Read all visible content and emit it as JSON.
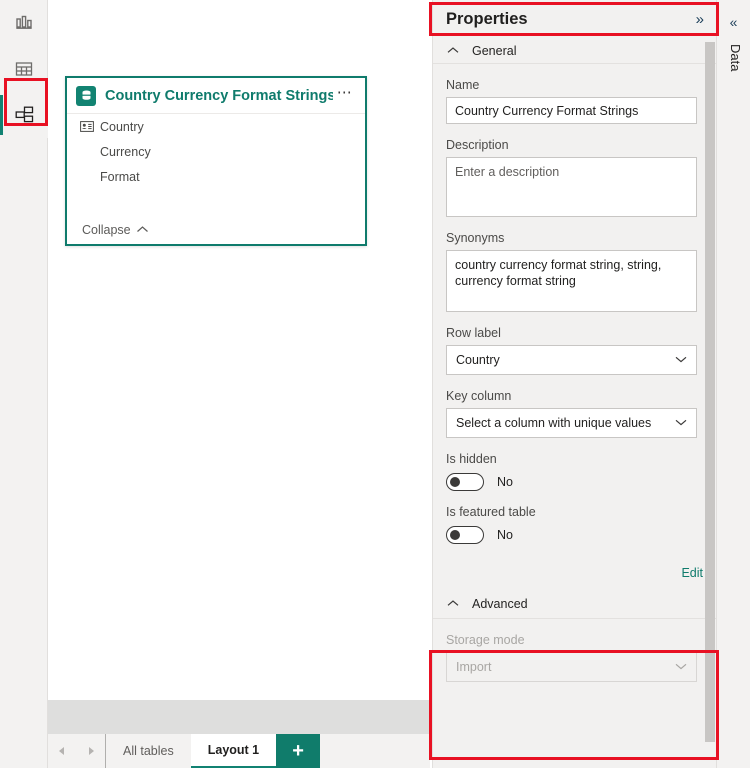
{
  "left_rail": {
    "items": [
      {
        "name": "report-view",
        "icon": "bar-chart-icon",
        "active": false
      },
      {
        "name": "data-view",
        "icon": "table-grid-icon",
        "active": false
      },
      {
        "name": "model-view",
        "icon": "model-relationship-icon",
        "active": true
      }
    ]
  },
  "canvas": {
    "table_card": {
      "icon": "database-table-icon",
      "title": "Country Currency Format Strings",
      "menu_icon": "ellipsis-icon",
      "fields": [
        {
          "label": "Country",
          "icon": "row-label-icon"
        },
        {
          "label": "Currency",
          "icon": ""
        },
        {
          "label": "Format",
          "icon": ""
        }
      ],
      "collapse_label": "Collapse",
      "collapse_icon": "chevron-up-icon",
      "border_color": "#0f7b6c"
    }
  },
  "tabbar": {
    "prev_icon": "chevron-left-icon",
    "next_icon": "chevron-right-icon",
    "tabs": [
      {
        "label": "All tables",
        "active": false
      },
      {
        "label": "Layout 1",
        "active": true
      }
    ],
    "add_label": "+",
    "add_color": "#107c6b"
  },
  "properties": {
    "title": "Properties",
    "expand_icon": "double-chevron-right-icon",
    "general": {
      "section_title": "General",
      "collapse_icon": "chevron-up-icon",
      "name_label": "Name",
      "name_value": "Country Currency Format Strings",
      "description_label": "Description",
      "description_placeholder": "Enter a description",
      "synonyms_label": "Synonyms",
      "synonyms_value": "country currency format string, string, currency format string",
      "row_label_label": "Row label",
      "row_label_value": "Country",
      "key_column_label": "Key column",
      "key_column_value": "Select a column with unique values",
      "is_hidden_label": "Is hidden",
      "is_hidden_value": "No",
      "is_featured_label": "Is featured table",
      "is_featured_value": "No",
      "edit_label": "Edit",
      "edit_color": "#0f7b6c"
    },
    "advanced": {
      "section_title": "Advanced",
      "collapse_icon": "chevron-up-icon",
      "storage_mode_label": "Storage mode",
      "storage_mode_value": "Import",
      "storage_mode_disabled": true
    },
    "dropdown_icon": "chevron-down-icon"
  },
  "data_rail": {
    "collapse_icon": "double-chevron-left-icon",
    "label": "Data"
  },
  "annotations": {
    "highlight_color": "#e81123",
    "boxes": [
      {
        "name": "model-view-highlight"
      },
      {
        "name": "properties-header-highlight"
      },
      {
        "name": "advanced-section-highlight"
      }
    ]
  }
}
